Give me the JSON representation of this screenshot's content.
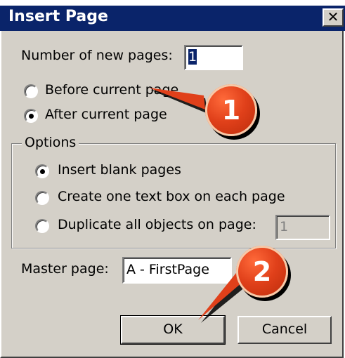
{
  "dialog": {
    "title": "Insert Page",
    "close_glyph": "✕",
    "num_pages_label": "Number of new pages:",
    "num_pages_value": "1",
    "position": {
      "before_label": "Before current page",
      "after_label": "After current page",
      "selected": "after"
    },
    "options": {
      "group_label": "Options",
      "blank_label": "Insert blank pages",
      "textbox_label": "Create one text box on each page",
      "duplicate_label": "Duplicate all objects on page:",
      "duplicate_value": "1",
      "selected": "blank"
    },
    "master_label": "Master page:",
    "master_value": "A - FirstPage",
    "ok_label": "OK",
    "cancel_label": "Cancel"
  },
  "callouts": {
    "one": "1",
    "two": "2",
    "color": "#e0401a"
  }
}
